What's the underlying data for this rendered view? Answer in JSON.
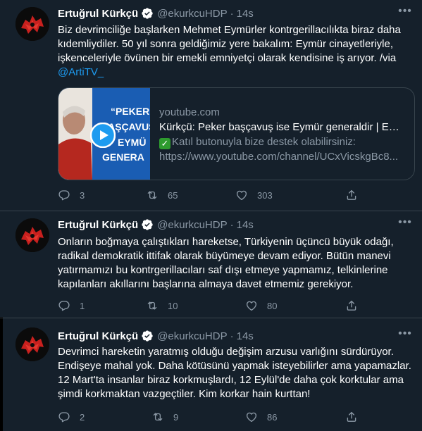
{
  "tweets": [
    {
      "name": "Ertuğrul Kürkçü",
      "handle": "@ekurkcuHDP",
      "dot": "·",
      "time": "14s",
      "text_lines": [
        "Biz devrimciliğe başlarken Mehmet Eymürler kontrgerillacılıkta biraz daha",
        "kıdemliydiler. 50 yıl sonra geldiğimiz yere bakalım: Eymür cinayetleriyle,",
        "işkenceleriyle övünen bir emekli emniyetçi olarak kendisine iş arıyor. /via"
      ],
      "mention": "@ArtiTV_",
      "card": {
        "domain": "youtube.com",
        "title": "Kürkçü: Peker başçavuş ise Eymür generaldir | Ezo ...",
        "check": "✓",
        "desc_line1": "Katıl butonuyla bize destek olabilirsiniz:",
        "desc_line2": "https://www.youtube.com/channel/UCxVicskgBc8...",
        "thumb_text": [
          "“PEKER",
          "BAŞÇAVUŞ",
          "EYMÜ",
          "GENERA"
        ]
      },
      "replies": "3",
      "retweets": "65",
      "likes": "303"
    },
    {
      "name": "Ertuğrul Kürkçü",
      "handle": "@ekurkcuHDP",
      "dot": "·",
      "time": "14s",
      "text_lines": [
        "Onların boğmaya çalıştıkları hareketse, Türkiyenin üçüncü büyük odağı,",
        "radikal demokratik ittifak olarak büyümeye devam ediyor. Bütün manevi",
        "yatırmamızı bu kontrgerillacıları saf dışı etmeye yapmamız, telkinlerine",
        "kapılanları akıllarını başlarına almaya davet etmemiz gerekiyor."
      ],
      "replies": "1",
      "retweets": "10",
      "likes": "80"
    },
    {
      "name": "Ertuğrul Kürkçü",
      "handle": "@ekurkcuHDP",
      "dot": "·",
      "time": "14s",
      "text_lines": [
        "Devrimci hareketin yaratmış olduğu değişim arzusu varlığını sürdürüyor.",
        "Endişeye mahal yok. Daha kötüsünü yapmak isteyebilirler ama yapamazlar.",
        "12 Mart'ta insanlar biraz korkmuşlardı, 12 Eylül'de daha çok korktular ama",
        "şimdi korkmaktan vazgeçtiler. Kim korkar hain kurttan!"
      ],
      "replies": "2",
      "retweets": "9",
      "likes": "86"
    }
  ],
  "colors": {
    "background": "#15202b",
    "text": "#ffffff",
    "muted": "#8b98a5",
    "link": "#1d9bf0",
    "border": "#38444d"
  }
}
